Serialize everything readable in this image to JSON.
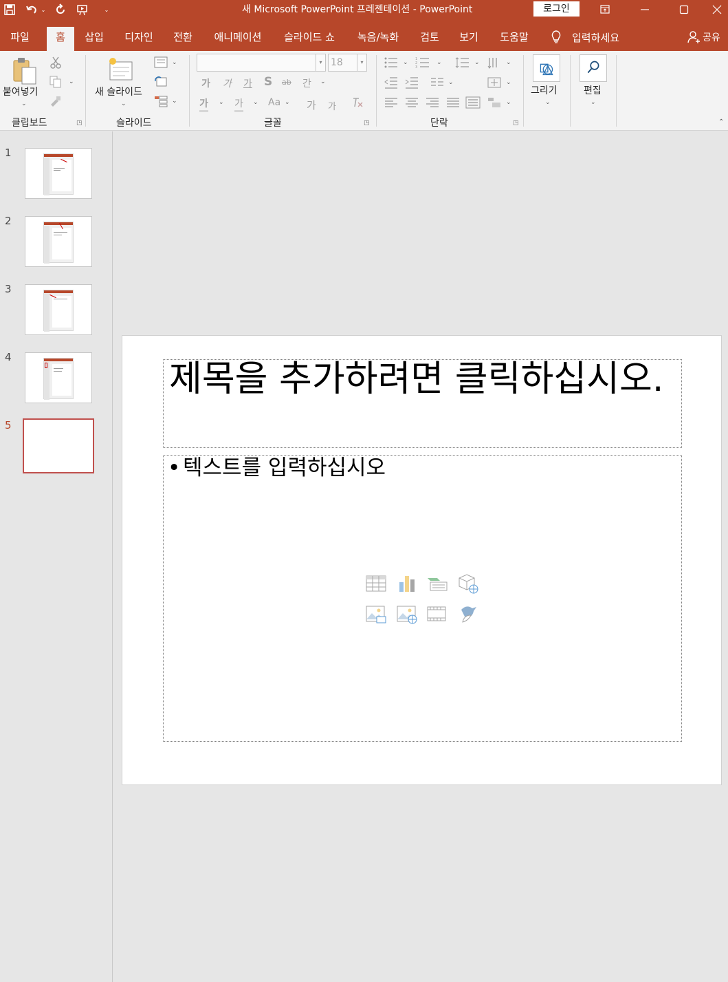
{
  "titlebar": {
    "title": "새 Microsoft PowerPoint 프레젠테이션  -  PowerPoint",
    "login": "로그인",
    "qat": [
      "save-icon",
      "undo-icon",
      "redo-icon",
      "start-from-beginning-icon",
      "customize-qat-icon"
    ]
  },
  "tabs": {
    "file": "파일",
    "home": "홈",
    "insert": "삽입",
    "design": "디자인",
    "transitions": "전환",
    "animations": "애니메이션",
    "slideshow": "슬라이드 쇼",
    "record": "녹음/녹화",
    "review": "검토",
    "view": "보기",
    "help": "도움말",
    "tell_me": "입력하세요",
    "share": "공유"
  },
  "ribbon": {
    "clipboard": {
      "label": "클립보드",
      "paste": "붙여넣기"
    },
    "slides": {
      "label": "슬라이드",
      "new_slide": "새 슬라이드"
    },
    "font": {
      "label": "글꼴",
      "name": "",
      "size": "18",
      "bold": "가",
      "italic": "가",
      "underline": "가",
      "shadow": "S",
      "strike": "ab",
      "spacing": "간",
      "highlight": "가",
      "color": "가",
      "case": "Aa",
      "grow": "가",
      "shrink": "가"
    },
    "paragraph": {
      "label": "단락"
    },
    "drawing": {
      "label": "그리기"
    },
    "editing": {
      "label": "편집"
    }
  },
  "thumbnails": {
    "items": [
      {
        "num": "1"
      },
      {
        "num": "2"
      },
      {
        "num": "3"
      },
      {
        "num": "4"
      },
      {
        "num": "5"
      }
    ],
    "active": "5"
  },
  "slide": {
    "title_placeholder": "제목을 추가하려면 클릭하십시오.",
    "body_placeholder": "텍스트를 입력하십시오",
    "bullet": "•",
    "insert_icons": [
      "table-icon",
      "chart-icon",
      "smartart-icon",
      "3d-model-icon",
      "pictures-icon",
      "online-pictures-icon",
      "video-icon",
      "icons-icon"
    ]
  },
  "colors": {
    "accent": "#b7472a",
    "ribbon_bg": "#f3f3f3",
    "workspace_bg": "#e6e6e6",
    "active_thumb_border": "#c0504d"
  }
}
